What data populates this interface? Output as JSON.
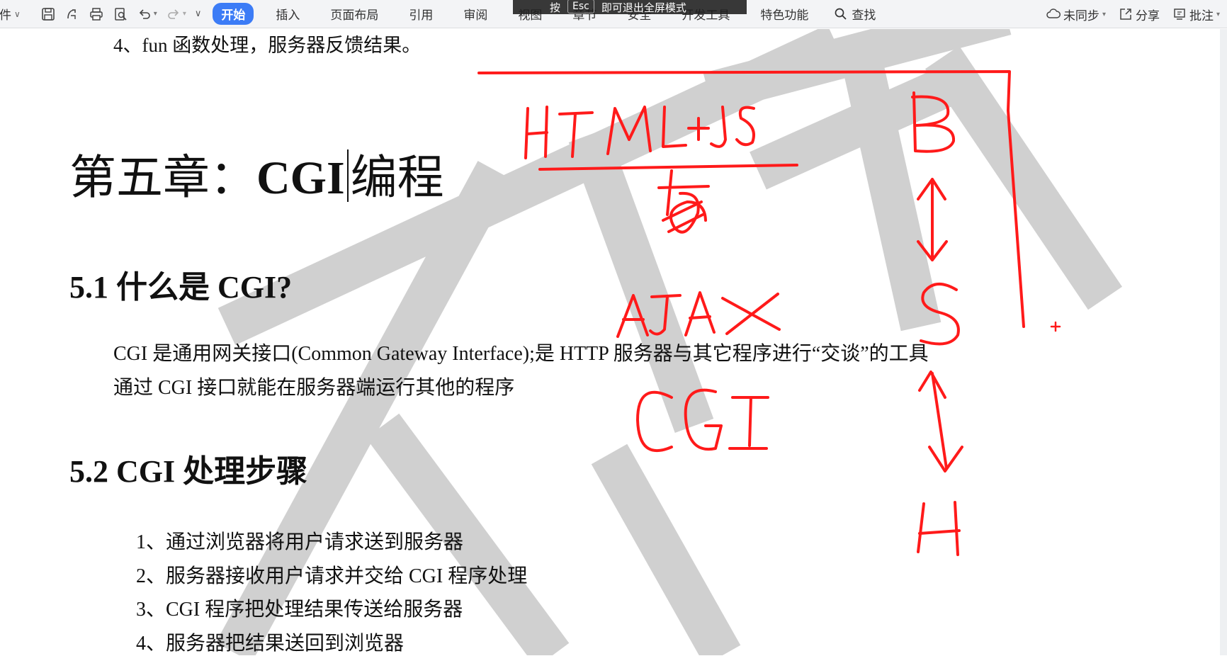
{
  "toolbar": {
    "file_label": "文件",
    "tabs": [
      {
        "label": "开始"
      },
      {
        "label": "插入"
      },
      {
        "label": "页面布局"
      },
      {
        "label": "引用"
      },
      {
        "label": "审阅"
      },
      {
        "label": "视图"
      },
      {
        "label": "章节"
      },
      {
        "label": "安全"
      },
      {
        "label": "开发工具"
      },
      {
        "label": "特色功能"
      }
    ],
    "active_tab": "开始",
    "search_label": "查找",
    "right": {
      "sync": "未同步",
      "share": "分享",
      "comment": "批注"
    },
    "accent_color": "#3c7cf6"
  },
  "esc_hint": {
    "prefix": "按",
    "key": "Esc",
    "suffix": "即可退出全屏模式"
  },
  "document": {
    "prev_item": "4、fun 函数处理，服务器反馈结果。",
    "chapter_prefix": "第五章：",
    "chapter_bold": "CGI",
    "chapter_suffix": "编程",
    "section1_num": "5.1",
    "section1_title": "什么是 CGI?",
    "section1_para1": "CGI 是通用网关接口(Common Gateway Interface);是 HTTP 服务器与其它程序进行“交谈”的工具",
    "section1_para2": "通过 CGI 接口就能在服务器端运行其他的程序",
    "section2_num": "5.2",
    "section2_title": "CGI 处理步骤",
    "steps": [
      "1、通过浏览器将用户请求送到服务器",
      "2、服务器接收用户请求并交给 CGI 程序处理",
      "3、CGI 程序把处理结果传送给服务器",
      "4、服务器把结果送回到浏览器"
    ]
  },
  "annotations": {
    "ink_color": "#ff1a1a",
    "label_html_js": "HTML+JS",
    "label_ajax": "AJAX",
    "label_cgi": "CGI",
    "label_b": "B",
    "label_s": "S",
    "label_h": "H"
  },
  "watermark_color": "#c8c8c8"
}
